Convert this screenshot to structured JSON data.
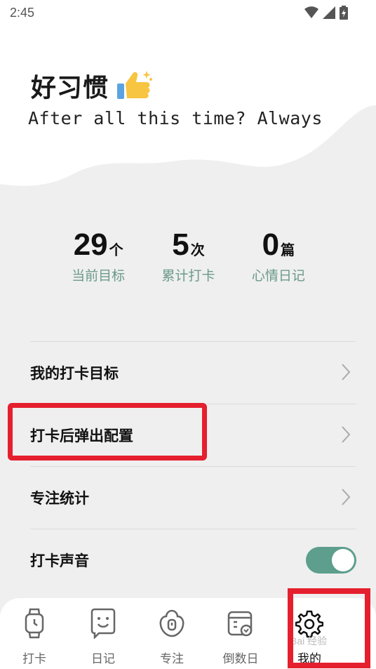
{
  "status_bar": {
    "time": "2:45"
  },
  "header": {
    "title": "好习惯",
    "subtitle": "After all this time? Always"
  },
  "stats": [
    {
      "value": "29",
      "unit": "个",
      "label": "当前目标"
    },
    {
      "value": "5",
      "unit": "次",
      "label": "累计打卡"
    },
    {
      "value": "0",
      "unit": "篇",
      "label": "心情日记"
    }
  ],
  "menu": [
    {
      "label": "我的打卡目标"
    },
    {
      "label": "打卡后弹出配置"
    },
    {
      "label": "专注统计"
    },
    {
      "label": "打卡声音",
      "toggle_on": true
    }
  ],
  "bottom_nav": [
    {
      "label": "打卡",
      "icon": "watch-icon"
    },
    {
      "label": "日记",
      "icon": "smile-note-icon"
    },
    {
      "label": "专注",
      "icon": "focus-icon"
    },
    {
      "label": "倒数日",
      "icon": "calendar-icon"
    },
    {
      "label": "我的",
      "icon": "gear-icon",
      "active": true
    }
  ],
  "watermark": "Bai 经验",
  "colors": {
    "accent": "#5d9e8d",
    "stat_label": "#6b9a8a",
    "highlight": "#e51f2e",
    "background": "#efefef"
  }
}
